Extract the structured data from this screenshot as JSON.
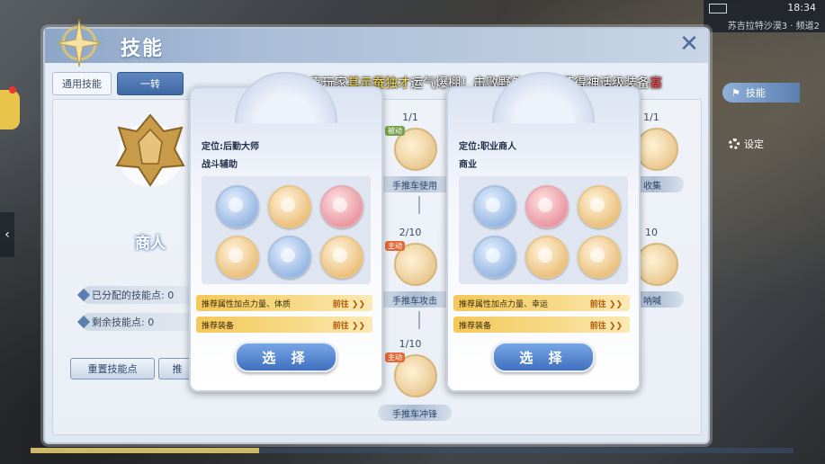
{
  "hud": {
    "time": "18:34",
    "server": "苏吉拉特沙漠3 · 频道2"
  },
  "side_menu": {
    "skills_label": "技能",
    "settings_label": "设定"
  },
  "window": {
    "title": "技能"
  },
  "banner": {
    "prefix": "恭喜玩家",
    "player": "其示蚕独才",
    "middle": "运气爆棚！击败野外怪物后获得神话级装备",
    "item": "塞"
  },
  "tabs": [
    {
      "label": "通用技能",
      "active": false
    },
    {
      "label": "一转",
      "active": true
    }
  ],
  "class_panel": {
    "class_name": "商人",
    "assigned_label": "已分配的技能点: 0",
    "remaining_label": "剩余技能点: 0",
    "reset_button": "重置技能点",
    "other_button": "推"
  },
  "skill_tree": [
    {
      "count": "1/1",
      "tag": "被动",
      "label": "手推车使用"
    },
    {
      "count": "2/10",
      "tag": "主动",
      "label": "手推车攻击"
    },
    {
      "count": "1/10",
      "tag": "主动",
      "label": "手推车冲锋"
    },
    {
      "count": "1/1",
      "label": "收集"
    },
    {
      "count": "10",
      "label": "呐喊"
    }
  ],
  "cards": [
    {
      "position": "定位:后勤大师",
      "role": "战斗辅助",
      "icons": [
        "blue",
        "gold",
        "red",
        "gold",
        "blue",
        "gold"
      ],
      "rec_attr": "推荐属性加点力量、体质",
      "rec_gear": "推荐装备",
      "go": "前往",
      "choose": "选 择"
    },
    {
      "position": "定位:职业商人",
      "role": "商业",
      "icons": [
        "blue",
        "red",
        "gold",
        "blue",
        "gold",
        "gold"
      ],
      "rec_attr": "推荐属性加点力量、幸运",
      "rec_gear": "推荐装备",
      "go": "前往",
      "choose": "选 择"
    }
  ],
  "colors": {
    "accent": "#3f68a3",
    "highlight": "#ffe04a",
    "gold_bar": "#f4c85a"
  }
}
